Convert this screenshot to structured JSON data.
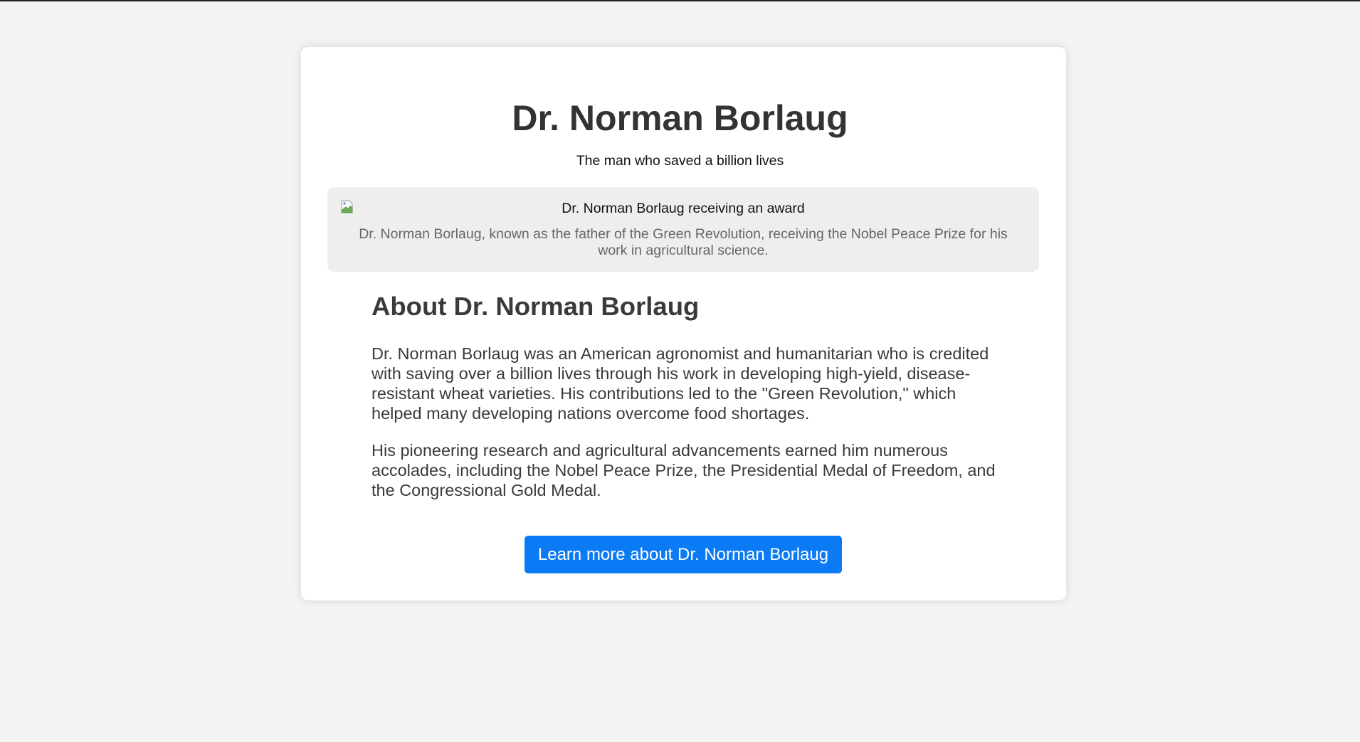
{
  "header": {
    "title": "Dr. Norman Borlaug",
    "subtitle": "The man who saved a billion lives"
  },
  "figure": {
    "image_alt": "Dr. Norman Borlaug receiving an award",
    "image_icon": "broken-image-icon",
    "caption": "Dr. Norman Borlaug, known as the father of the Green Revolution, receiving the Nobel Peace Prize for his work in agricultural science."
  },
  "about": {
    "heading": "About Dr. Norman Borlaug",
    "paragraphs": [
      "Dr. Norman Borlaug was an American agronomist and humanitarian who is credited with saving over a billion lives through his work in developing high-yield, disease-resistant wheat varieties. His contributions led to the \"Green Revolution,\" which helped many developing nations overcome food shortages.",
      "His pioneering research and agricultural advancements earned him numerous accolades, including the Nobel Peace Prize, the Presidential Medal of Freedom, and the Congressional Gold Medal."
    ]
  },
  "cta": {
    "label": "Learn more about Dr. Norman Borlaug"
  },
  "colors": {
    "page_background": "#f3f3f3",
    "card_background": "#ffffff",
    "figure_background": "#eeeeee",
    "button_background": "#0b7bf5",
    "button_text": "#ffffff",
    "heading_text": "#333333",
    "caption_text": "#666666"
  }
}
